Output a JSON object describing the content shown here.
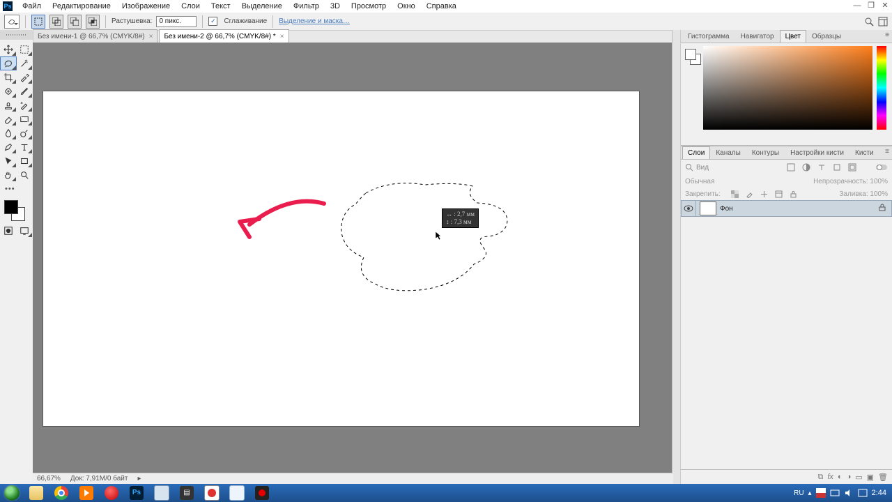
{
  "menu": {
    "items": [
      "Файл",
      "Редактирование",
      "Изображение",
      "Слои",
      "Текст",
      "Выделение",
      "Фильтр",
      "3D",
      "Просмотр",
      "Окно",
      "Справка"
    ]
  },
  "window_buttons": {
    "min": "—",
    "max": "❐",
    "close": "✕"
  },
  "options": {
    "feather_label": "Растушевка:",
    "feather_value": "0 пикс.",
    "antialias_label": "Сглаживание",
    "select_mask": "Выделение и маска…"
  },
  "doc_tabs": [
    {
      "title": "Без имени-1 @ 66,7% (CMYK/8#)",
      "active": false
    },
    {
      "title": "Без имени-2 @ 66,7% (CMYK/8#) *",
      "active": true
    }
  ],
  "measure": {
    "line1": "↔ : 2,7 мм",
    "line2": "↕ : 7,3 мм"
  },
  "status": {
    "zoom": "66,67%",
    "doc": "Док: 7,91M/0 байт"
  },
  "color_panel": {
    "tabs": [
      "Гистограмма",
      "Навигатор",
      "Цвет",
      "Образцы"
    ],
    "active": 2
  },
  "layers_panel": {
    "tabs": [
      "Слои",
      "Каналы",
      "Контуры",
      "Настройки кисти",
      "Кисти"
    ],
    "active": 0,
    "search_placeholder": "Вид",
    "blend": "Обычная",
    "opacity_label": "Непрозрачность:",
    "opacity": "100%",
    "lock_label": "Закрепить:",
    "fill_label": "Заливка:",
    "fill": "100%",
    "layer_name": "Фон"
  },
  "tray": {
    "lang": "RU",
    "time": "2:44"
  }
}
